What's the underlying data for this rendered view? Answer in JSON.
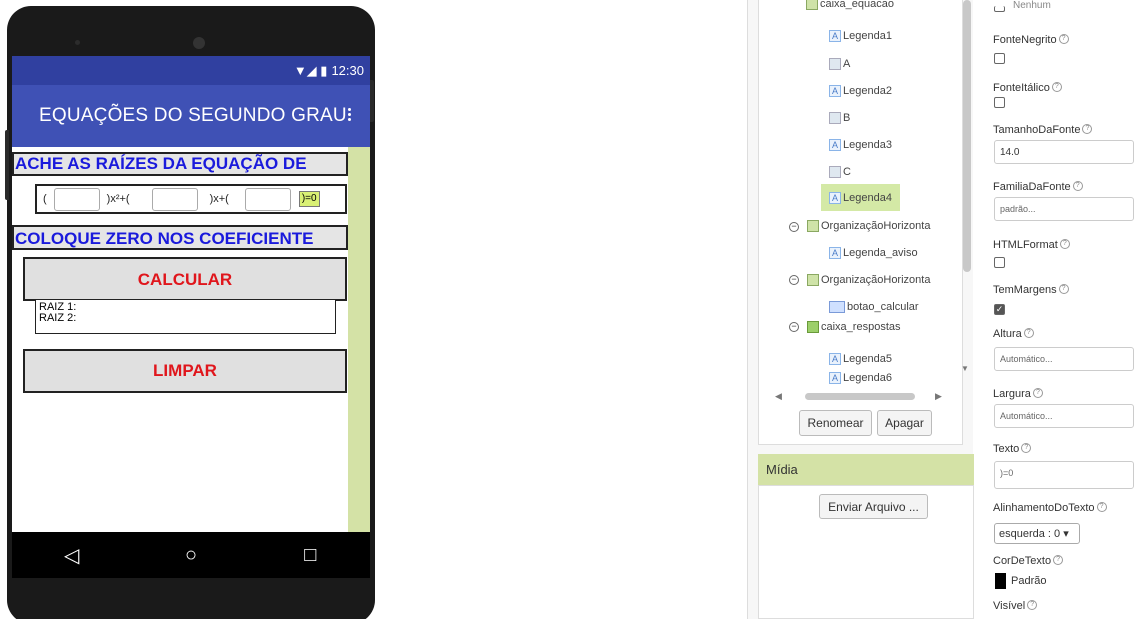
{
  "phone": {
    "status_time": "12:30",
    "status_icons": "▼◢ ▮",
    "app_title": "EQUAÇÕES DO SEGUNDO GRAU",
    "header_label": "ACHE AS RAÍZES DA EQUAÇÃO DE",
    "equation": {
      "open_paren": "(",
      "x2_suffix": ")x²+(",
      "x_suffix": ")x+(",
      "end_label": ")=0"
    },
    "hint_label": "COLOQUE ZERO NOS COEFICIENTE",
    "calc_button": "CALCULAR",
    "root1": "RAIZ 1:",
    "root2": "RAIZ 2:",
    "clear_button": "LIMPAR",
    "nav": {
      "back": "◁",
      "home": "○",
      "recent": "□"
    }
  },
  "tree": {
    "nodes": [
      {
        "label": "caixa_equacao"
      },
      {
        "label": "Legenda1"
      },
      {
        "label": "A"
      },
      {
        "label": "Legenda2"
      },
      {
        "label": "B"
      },
      {
        "label": "Legenda3"
      },
      {
        "label": "C"
      },
      {
        "label": "Legenda4"
      },
      {
        "label": "OrganizaçãoHorizonta"
      },
      {
        "label": "Legenda_aviso"
      },
      {
        "label": "OrganizaçãoHorizonta"
      },
      {
        "label": "botao_calcular"
      },
      {
        "label": "caixa_respostas"
      },
      {
        "label": "Legenda5"
      },
      {
        "label": "Legenda6"
      }
    ],
    "rename_button": "Renomear",
    "delete_button": "Apagar"
  },
  "media": {
    "title": "Mídia",
    "upload_button": "Enviar Arquivo ..."
  },
  "properties": {
    "none_label": "Nenhum",
    "bold_label": "FonteNegrito",
    "italic_label": "FonteItálico",
    "font_size_label": "TamanhoDaFonte",
    "font_size_value": "14.0",
    "font_family_label": "FamiliaDaFonte",
    "font_family_value": "padrão...",
    "html_label": "HTMLFormat",
    "margins_label": "TemMargens",
    "height_label": "Altura",
    "height_value": "Automático...",
    "width_label": "Largura",
    "width_value": "Automático...",
    "text_label": "Texto",
    "text_value": ")=0",
    "align_label": "AlinhamentoDoTexto",
    "align_value": "esquerda : 0 ▾",
    "color_label": "CorDeTexto",
    "color_value": "Padrão",
    "visible_label": "Visível",
    "help_glyph": "?",
    "check_glyph": "✓"
  },
  "colors": {
    "app_bar": "#3f51b5",
    "status_bar": "#3040a0",
    "label_blue": "#1a1adc",
    "button_red": "#e0161c",
    "selection_green": "#d4e9a6"
  }
}
